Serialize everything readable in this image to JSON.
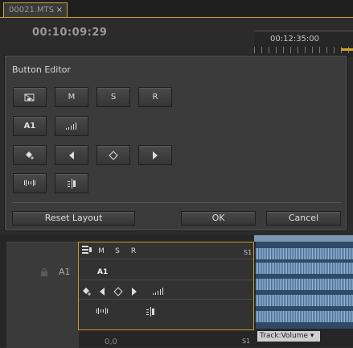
{
  "tab": {
    "label": "00021.MTS",
    "close": "×"
  },
  "timeline": {
    "timecode": "00:10:09:29",
    "ruler_time": "00:12:35:00",
    "track_label": "A1",
    "track_bottom_value": "0,0",
    "track_bottom_s1": "S1",
    "track_volume": "Track:Volume ▾"
  },
  "track_controls": {
    "m": "M",
    "s": "S",
    "r": "R",
    "s1": "S1",
    "a1": "A1"
  },
  "dialog": {
    "title": "Button Editor",
    "buttons": {
      "mute": "M",
      "solo": "S",
      "record": "R",
      "a1": "A1"
    },
    "reset_label": "Reset Layout",
    "ok_label": "OK",
    "cancel_label": "Cancel"
  },
  "colors": {
    "accent": "#d3a52a",
    "clip": "#2f4a66"
  }
}
